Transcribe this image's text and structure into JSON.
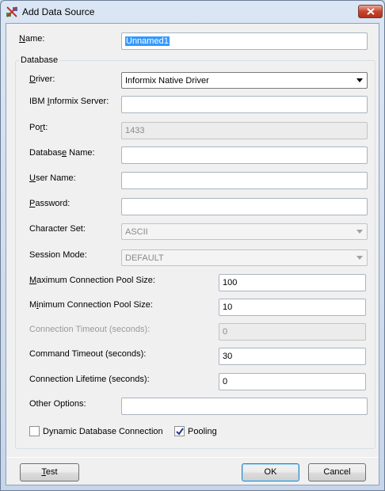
{
  "window": {
    "title": "Add Data Source"
  },
  "form": {
    "name_label": "Name:",
    "name_value": "Unnamed1",
    "database_group": "Database",
    "driver_label": "Driver:",
    "driver_value": "Informix Native Driver",
    "server_label": "IBM Informix Server:",
    "server_value": "",
    "port_label": "Port:",
    "port_value": "1433",
    "dbname_label": "Database Name:",
    "dbname_value": "",
    "username_label": "User Name:",
    "username_value": "",
    "password_label": "Password:",
    "password_value": "",
    "charset_label": "Character Set:",
    "charset_value": "ASCII",
    "session_label": "Session Mode:",
    "session_value": "DEFAULT",
    "maxpool_label": "Maximum Connection Pool Size:",
    "maxpool_value": "100",
    "minpool_label": "Minimum Connection Pool Size:",
    "minpool_value": "10",
    "conntimeout_label": "Connection Timeout (seconds):",
    "conntimeout_value": "0",
    "cmdtimeout_label": "Command Timeout (seconds):",
    "cmdtimeout_value": "30",
    "lifetime_label": "Connection Lifetime (seconds):",
    "lifetime_value": "0",
    "options_label": "Other Options:",
    "options_value": "",
    "dynamic_label": "Dynamic Database Connection",
    "dynamic_checked": false,
    "pooling_label": "Pooling",
    "pooling_checked": true
  },
  "buttons": {
    "test": "Test",
    "ok": "OK",
    "cancel": "Cancel"
  },
  "colors": {
    "selection": "#3399ff",
    "close_button": "#c6452e",
    "dialog_bg": "#f0f0f0"
  }
}
